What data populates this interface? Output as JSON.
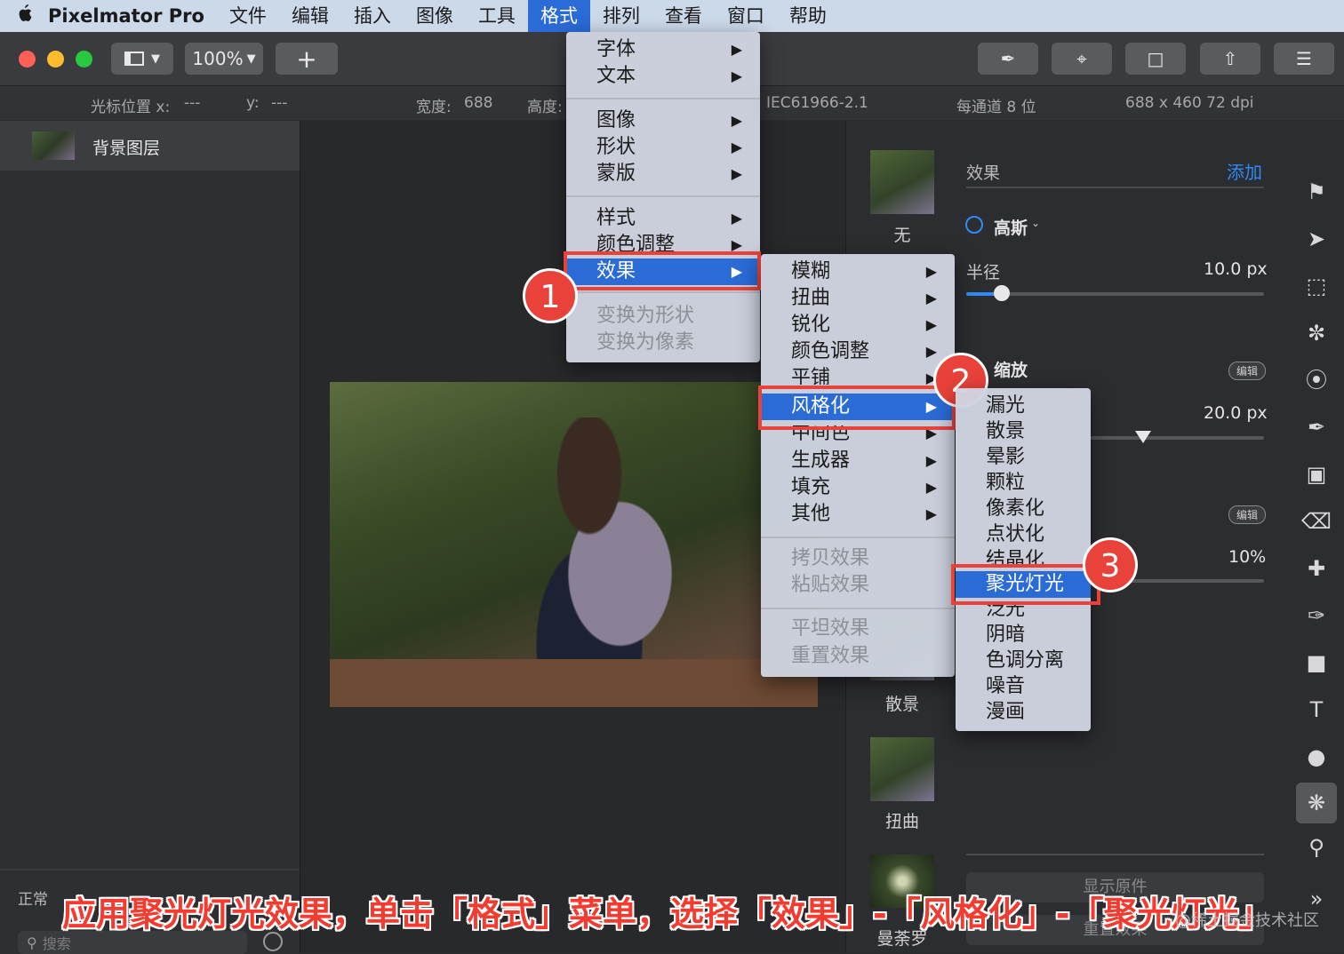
{
  "menubar": {
    "apple": "",
    "app": "Pixelmator Pro",
    "items": [
      "文件",
      "编辑",
      "插入",
      "图像",
      "工具",
      "格式",
      "排列",
      "查看",
      "窗口",
      "帮助"
    ],
    "active_index": 5
  },
  "toolbar": {
    "zoom": "100%",
    "add": "+",
    "colors": {
      "close": "#fe5f57",
      "minimize": "#febc2e",
      "zoom": "#28c840"
    }
  },
  "infobar": {
    "cursor_x_label": "光标位置 x:",
    "cursor_x_value": "---",
    "cursor_y_label": "y:",
    "cursor_y_value": "---",
    "width_label": "宽度:",
    "width_value": "688",
    "height_label": "高度:",
    "profile": "IEC61966-2.1",
    "depth": "每通道 8 位",
    "size": "688 x 460 72 dpi"
  },
  "layers": {
    "item": "背景图层",
    "blend": "正常",
    "search_placeholder": "搜索"
  },
  "format_menu": {
    "items": [
      {
        "label": "字体",
        "submenu": true
      },
      {
        "label": "文本",
        "submenu": true
      },
      {
        "label": "图像",
        "submenu": true
      },
      {
        "label": "形状",
        "submenu": true
      },
      {
        "label": "蒙版",
        "submenu": true
      },
      {
        "label": "样式",
        "submenu": true
      },
      {
        "label": "颜色调整",
        "submenu": true
      },
      {
        "label": "效果",
        "submenu": true,
        "selected": true
      },
      {
        "label": "变换为形状",
        "disabled": true
      },
      {
        "label": "变换为像素",
        "disabled": true
      }
    ]
  },
  "effects_menu": {
    "items": [
      {
        "label": "模糊",
        "submenu": true
      },
      {
        "label": "扭曲",
        "submenu": true
      },
      {
        "label": "锐化",
        "submenu": true
      },
      {
        "label": "颜色调整",
        "submenu": true
      },
      {
        "label": "平铺",
        "submenu": true
      },
      {
        "label": "风格化",
        "submenu": true,
        "selected": true
      },
      {
        "label": "中间色",
        "submenu": true
      },
      {
        "label": "生成器",
        "submenu": true
      },
      {
        "label": "填充",
        "submenu": true
      },
      {
        "label": "其他",
        "submenu": true
      },
      {
        "label": "拷贝效果",
        "disabled": true
      },
      {
        "label": "粘贴效果",
        "disabled": true
      },
      {
        "label": "平坦效果",
        "disabled": true
      },
      {
        "label": "重置效果",
        "disabled": true
      }
    ]
  },
  "stylize_menu": {
    "items": [
      "漏光",
      "散景",
      "晕影",
      "颗粒",
      "像素化",
      "点状化",
      "结晶化",
      "聚光灯光",
      "泛光",
      "阴暗",
      "色调分离",
      "噪音",
      "漫画"
    ],
    "selected_index": 7
  },
  "callouts": [
    "1",
    "2",
    "3"
  ],
  "effects_panel": {
    "header": "效果",
    "add": "添加",
    "presets": [
      "无",
      "散景",
      "扭曲",
      "曼荼罗"
    ],
    "effect1_name": "高斯",
    "radius_label": "半径",
    "radius_value": "10.0 px",
    "radius_fraction": 0.12,
    "effect2_name": "缩放",
    "edit_badge": "编辑",
    "value2": "20.0 px",
    "value3": "10%",
    "show_original": "显示原件",
    "reset": "重置效果"
  },
  "caption": "应用聚光灯光效果，单击「格式」菜单，选择「效果」-「风格化」-「聚光灯光」",
  "watermark": "@稀土掘金技术社区"
}
